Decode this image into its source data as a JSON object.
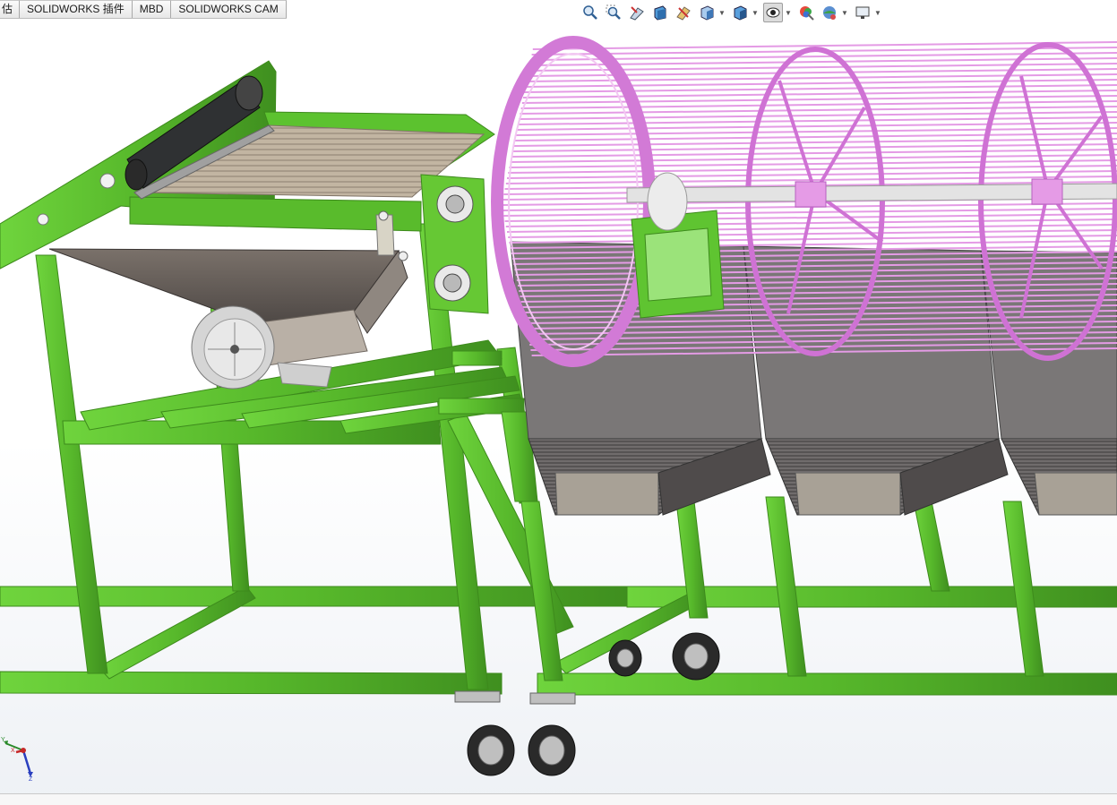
{
  "tabs": [
    {
      "label": "估"
    },
    {
      "label": "SOLIDWORKS 插件"
    },
    {
      "label": "MBD"
    },
    {
      "label": "SOLIDWORKS CAM"
    }
  ],
  "heads_up_toolbar": [
    {
      "icon": "zoom-to-fit-icon"
    },
    {
      "icon": "zoom-to-area-icon"
    },
    {
      "icon": "previous-view-icon"
    },
    {
      "icon": "section-view-icon"
    },
    {
      "icon": "dynamic-annotation-icon"
    },
    {
      "icon": "view-orientation-icon",
      "dropdown": true
    },
    {
      "icon": "display-style-icon",
      "dropdown": true
    },
    {
      "icon": "hide-show-items-icon",
      "dropdown": true,
      "active": true
    },
    {
      "icon": "edit-appearance-icon"
    },
    {
      "icon": "apply-scene-icon",
      "dropdown": true
    },
    {
      "icon": "view-settings-icon",
      "dropdown": true
    }
  ],
  "triad": {
    "x_label": "X",
    "y_label": "Y",
    "z_label": "Z"
  },
  "colors": {
    "frame_green": "#5fc431",
    "frame_green_dark": "#3f8f1f",
    "drum_pink": "#e59ae6",
    "drum_pink_dark": "#b760c0",
    "hopper_gray": "#6b6560",
    "hopper_light": "#b4aca2"
  }
}
